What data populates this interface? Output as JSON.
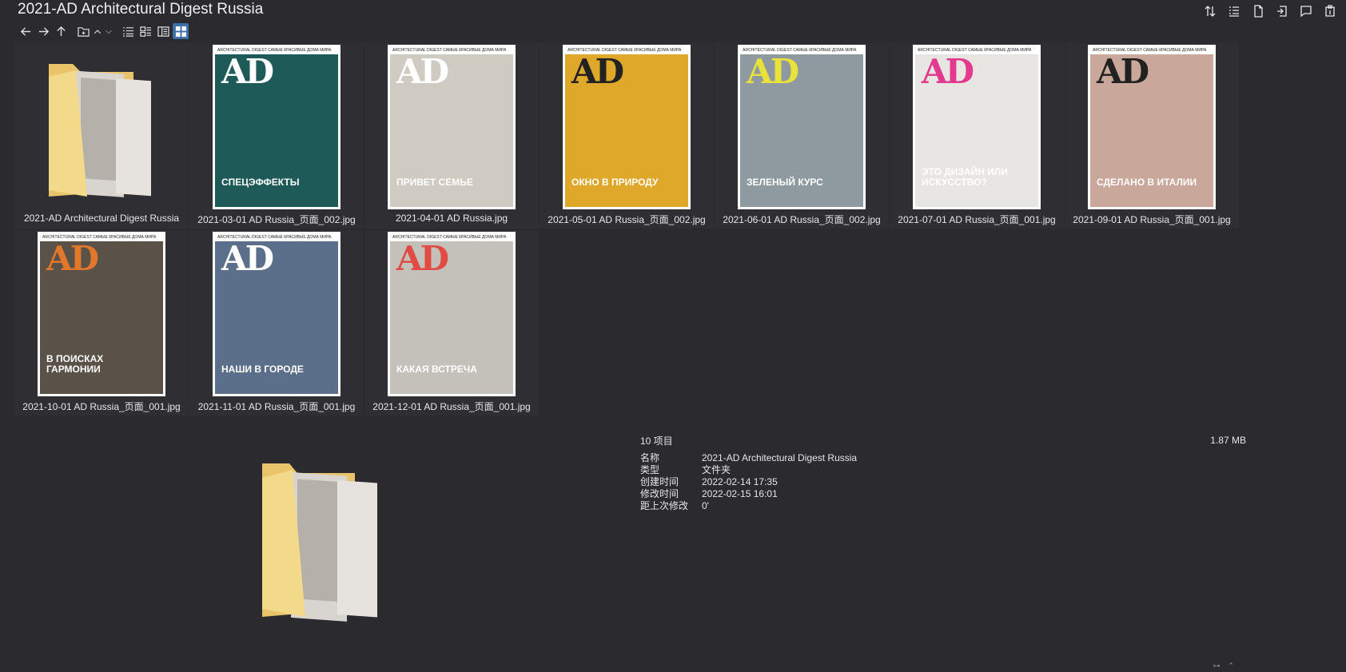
{
  "window": {
    "title": "2021-AD Architectural Digest Russia"
  },
  "top_icons": [
    "sort-icon",
    "details-icon",
    "document-icon",
    "export-icon",
    "note-icon",
    "clipboard-icon"
  ],
  "items": [
    {
      "name": "2021-AD Architectural Digest Russia",
      "type": "folder"
    },
    {
      "name": "2021-03-01 AD Russia_页面_002.jpg",
      "type": "image",
      "bg": "#1e5a57",
      "ad_color": "#ffffff",
      "headline": "СПЕЦЭФФЕКТЫ"
    },
    {
      "name": "2021-04-01 AD Russia.jpg",
      "type": "image",
      "bg": "#cfcac2",
      "ad_color": "#ffffff",
      "headline": "ПРИВЕТ СЕМЬЕ"
    },
    {
      "name": "2021-05-01 AD Russia_页面_002.jpg",
      "type": "image",
      "bg": "#e0a82b",
      "ad_color": "#222222",
      "headline": "ОКНО В ПРИРОДУ"
    },
    {
      "name": "2021-06-01 AD Russia_页面_002.jpg",
      "type": "image",
      "bg": "#8f9aa0",
      "ad_color": "#e8e23a",
      "headline": "ЗЕЛЕНЫЙ КУРС"
    },
    {
      "name": "2021-07-01 AD Russia_页面_001.jpg",
      "type": "image",
      "bg": "#e8e6e2",
      "ad_color": "#e33a8f",
      "headline": "ЭТО ДИЗАЙН ИЛИ ИСКУССТВО?"
    },
    {
      "name": "2021-09-01 AD Russia_页面_001.jpg",
      "type": "image",
      "bg": "#c9a79a",
      "ad_color": "#222222",
      "headline": "СДЕЛАНО В ИТАЛИИ"
    },
    {
      "name": "2021-10-01 AD Russia_页面_001.jpg",
      "type": "image",
      "bg": "#5a5149",
      "ad_color": "#e0772b",
      "headline": "В ПОИСКАХ ГАРМОНИИ"
    },
    {
      "name": "2021-11-01 AD Russia_页面_001.jpg",
      "type": "image",
      "bg": "#5b6f8a",
      "ad_color": "#ffffff",
      "headline": "НАШИ В ГОРОДЕ"
    },
    {
      "name": "2021-12-01 AD Russia_页面_001.jpg",
      "type": "image",
      "bg": "#c4c0ba",
      "ad_color": "#e24b43",
      "headline": "КАКАЯ ВСТРЕЧА"
    }
  ],
  "cover_mast": "ARCHITECTURAL DIGEST САМЫЕ КРАСИВЫЕ ДОМА МИРА",
  "status": {
    "count": "10 项目",
    "size": "1.87 MB"
  },
  "details": [
    {
      "key": "名称",
      "value": "2021-AD Architectural Digest Russia"
    },
    {
      "key": "类型",
      "value": "文件夹"
    },
    {
      "key": "创建时间",
      "value": "2022-02-14  17:35"
    },
    {
      "key": "修改时间",
      "value": "2022-02-15  16:01"
    },
    {
      "key": "距上次修改",
      "value": "0'"
    }
  ]
}
